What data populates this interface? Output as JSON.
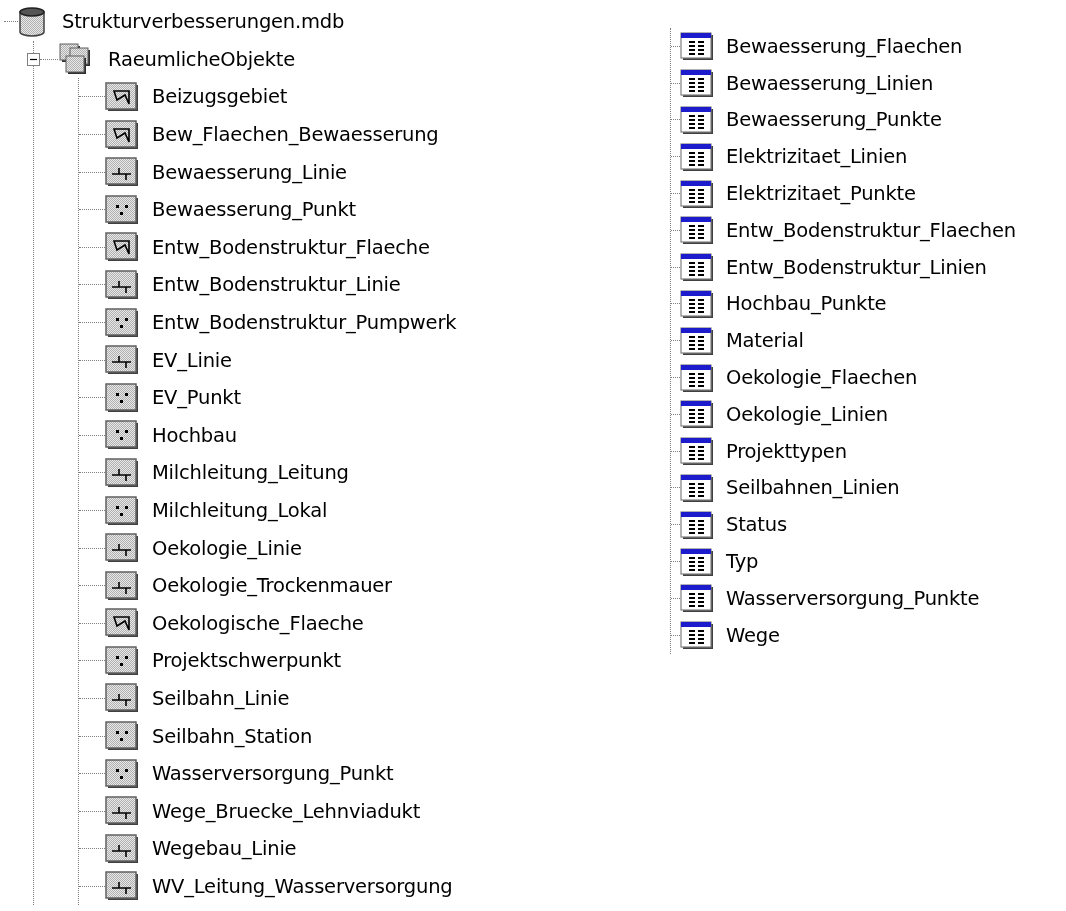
{
  "tree": {
    "name": "Strukturverbesserungen.mdb",
    "kind": "database",
    "children": [
      {
        "name": "RaeumlicheObjekte",
        "kind": "dataset",
        "expanded": true,
        "children": [
          {
            "name": "Beizugsgebiet",
            "kind": "polygon"
          },
          {
            "name": "Bew_Flaechen_Bewaesserung",
            "kind": "polygon"
          },
          {
            "name": "Bewaesserung_Linie",
            "kind": "line"
          },
          {
            "name": "Bewaesserung_Punkt",
            "kind": "point"
          },
          {
            "name": "Entw_Bodenstruktur_Flaeche",
            "kind": "polygon"
          },
          {
            "name": "Entw_Bodenstruktur_Linie",
            "kind": "line"
          },
          {
            "name": "Entw_Bodenstruktur_Pumpwerk",
            "kind": "point"
          },
          {
            "name": "EV_Linie",
            "kind": "line"
          },
          {
            "name": "EV_Punkt",
            "kind": "point"
          },
          {
            "name": "Hochbau",
            "kind": "point"
          },
          {
            "name": "Milchleitung_Leitung",
            "kind": "line"
          },
          {
            "name": "Milchleitung_Lokal",
            "kind": "point"
          },
          {
            "name": "Oekologie_Linie",
            "kind": "line"
          },
          {
            "name": "Oekologie_Trockenmauer",
            "kind": "line"
          },
          {
            "name": "Oekologische_Flaeche",
            "kind": "polygon"
          },
          {
            "name": "Projektschwerpunkt",
            "kind": "point"
          },
          {
            "name": "Seilbahn_Linie",
            "kind": "line"
          },
          {
            "name": "Seilbahn_Station",
            "kind": "point"
          },
          {
            "name": "Wasserversorgung_Punkt",
            "kind": "point"
          },
          {
            "name": "Wege_Bruecke_Lehnviadukt",
            "kind": "line"
          },
          {
            "name": "Wegebau_Linie",
            "kind": "line"
          },
          {
            "name": "WV_Leitung_Wasserversorgung",
            "kind": "line"
          }
        ]
      },
      {
        "name": "Bewaesserung_Flaechen",
        "kind": "table"
      },
      {
        "name": "Bewaesserung_Linien",
        "kind": "table"
      },
      {
        "name": "Bewaesserung_Punkte",
        "kind": "table"
      },
      {
        "name": "Elektrizitaet_Linien",
        "kind": "table"
      },
      {
        "name": "Elektrizitaet_Punkte",
        "kind": "table"
      },
      {
        "name": "Entw_Bodenstruktur_Flaechen",
        "kind": "table"
      },
      {
        "name": "Entw_Bodenstruktur_Linien",
        "kind": "table"
      },
      {
        "name": "Hochbau_Punkte",
        "kind": "table"
      },
      {
        "name": "Material",
        "kind": "table"
      },
      {
        "name": "Oekologie_Flaechen",
        "kind": "table"
      },
      {
        "name": "Oekologie_Linien",
        "kind": "table"
      },
      {
        "name": "Projekttypen",
        "kind": "table"
      },
      {
        "name": "Seilbahnen_Linien",
        "kind": "table"
      },
      {
        "name": "Status",
        "kind": "table"
      },
      {
        "name": "Typ",
        "kind": "table"
      },
      {
        "name": "Wasserversorgung_Punkte",
        "kind": "table"
      },
      {
        "name": "Wege",
        "kind": "table"
      }
    ]
  }
}
